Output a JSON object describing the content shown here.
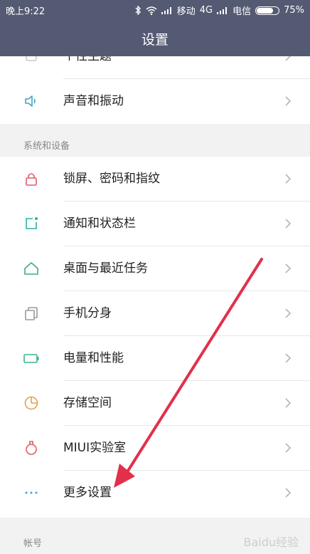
{
  "status_bar": {
    "time": "晚上9:22",
    "carrier1": "移动",
    "network": "4G",
    "carrier2": "电信",
    "battery": "75%",
    "battery_level": 0.75
  },
  "header": {
    "title": "设置"
  },
  "partial_top_item": {
    "label": "个性主题"
  },
  "sound_item": {
    "label": "声音和振动"
  },
  "system_section": {
    "heading": "系统和设备",
    "items": [
      {
        "label": "锁屏、密码和指纹",
        "icon": "lock-icon"
      },
      {
        "label": "通知和状态栏",
        "icon": "notification-icon"
      },
      {
        "label": "桌面与最近任务",
        "icon": "home-icon"
      },
      {
        "label": "手机分身",
        "icon": "dual-space-icon"
      },
      {
        "label": "电量和性能",
        "icon": "battery-icon"
      },
      {
        "label": "存储空间",
        "icon": "storage-icon"
      },
      {
        "label": "MIUI实验室",
        "icon": "lab-flask-icon"
      },
      {
        "label": "更多设置",
        "icon": "more-icon"
      }
    ]
  },
  "account_section": {
    "heading": "帐号"
  },
  "watermark": "Baidu经验",
  "colors": {
    "header": "#555a73",
    "accent_red": "#e2304a"
  }
}
